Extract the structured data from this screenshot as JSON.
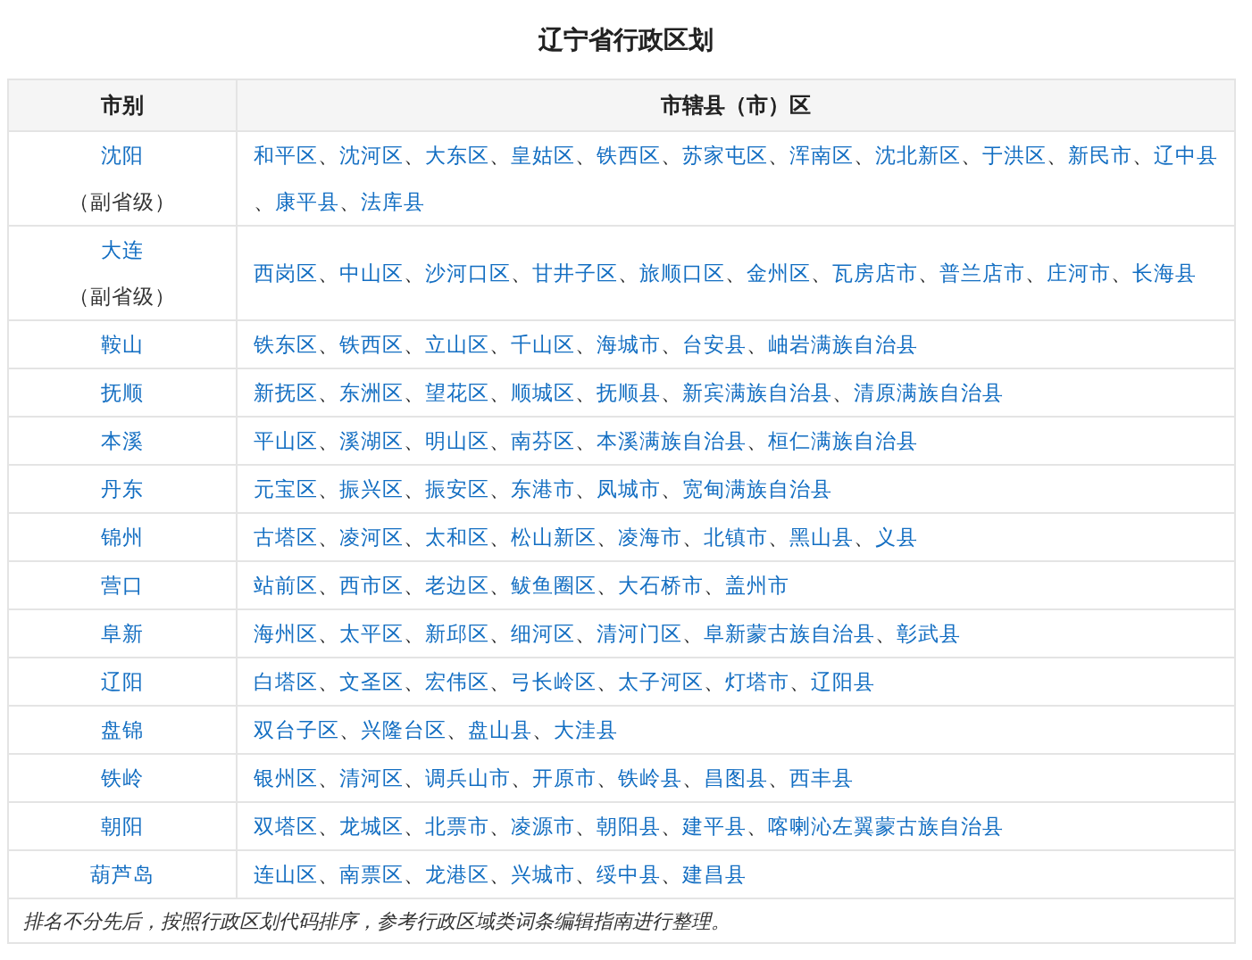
{
  "title": "辽宁省行政区划",
  "columns": [
    "市别",
    "市辖县（市）区"
  ],
  "rows": [
    {
      "city": "沈阳",
      "note": "（副省级）",
      "districts": [
        "和平区",
        "沈河区",
        "大东区",
        "皇姑区",
        "铁西区",
        "苏家屯区",
        "浑南区",
        "沈北新区",
        "于洪区",
        "新民市",
        "辽中县",
        "康平县",
        "法库县"
      ]
    },
    {
      "city": "大连",
      "note": "（副省级）",
      "districts": [
        "西岗区",
        "中山区",
        "沙河口区",
        "甘井子区",
        "旅顺口区",
        "金州区",
        "瓦房店市",
        "普兰店市",
        "庄河市",
        "长海县"
      ]
    },
    {
      "city": "鞍山",
      "districts": [
        "铁东区",
        "铁西区",
        "立山区",
        "千山区",
        "海城市",
        "台安县",
        "岫岩满族自治县"
      ]
    },
    {
      "city": "抚顺",
      "districts": [
        "新抚区",
        "东洲区",
        "望花区",
        "顺城区",
        "抚顺县",
        "新宾满族自治县",
        "清原满族自治县"
      ]
    },
    {
      "city": "本溪",
      "districts": [
        "平山区",
        "溪湖区",
        "明山区",
        "南芬区",
        "本溪满族自治县",
        "桓仁满族自治县"
      ]
    },
    {
      "city": "丹东",
      "districts": [
        "元宝区",
        "振兴区",
        "振安区",
        "东港市",
        "凤城市",
        "宽甸满族自治县"
      ]
    },
    {
      "city": "锦州",
      "districts": [
        "古塔区",
        "凌河区",
        "太和区",
        "松山新区",
        "凌海市",
        "北镇市",
        "黑山县",
        "义县"
      ]
    },
    {
      "city": "营口",
      "districts": [
        "站前区",
        "西市区",
        "老边区",
        "鲅鱼圈区",
        "大石桥市",
        "盖州市"
      ]
    },
    {
      "city": "阜新",
      "districts": [
        "海州区",
        "太平区",
        "新邱区",
        "细河区",
        "清河门区",
        "阜新蒙古族自治县",
        "彰武县"
      ]
    },
    {
      "city": "辽阳",
      "districts": [
        "白塔区",
        "文圣区",
        "宏伟区",
        "弓长岭区",
        "太子河区",
        "灯塔市",
        "辽阳县"
      ]
    },
    {
      "city": "盘锦",
      "districts": [
        "双台子区",
        "兴隆台区",
        "盘山县",
        "大洼县"
      ]
    },
    {
      "city": "铁岭",
      "districts": [
        "银州区",
        "清河区",
        "调兵山市",
        "开原市",
        "铁岭县",
        "昌图县",
        "西丰县"
      ]
    },
    {
      "city": "朝阳",
      "districts": [
        "双塔区",
        "龙城区",
        "北票市",
        "凌源市",
        "朝阳县",
        "建平县",
        "喀喇沁左翼蒙古族自治县"
      ]
    },
    {
      "city": "葫芦岛",
      "districts": [
        "连山区",
        "南票区",
        "龙港区",
        "兴城市",
        "绥中县",
        "建昌县"
      ]
    }
  ],
  "separator": "、",
  "footnote": "排名不分先后，按照行政区划代码排序，参考行政区域类词条编辑指南进行整理。"
}
